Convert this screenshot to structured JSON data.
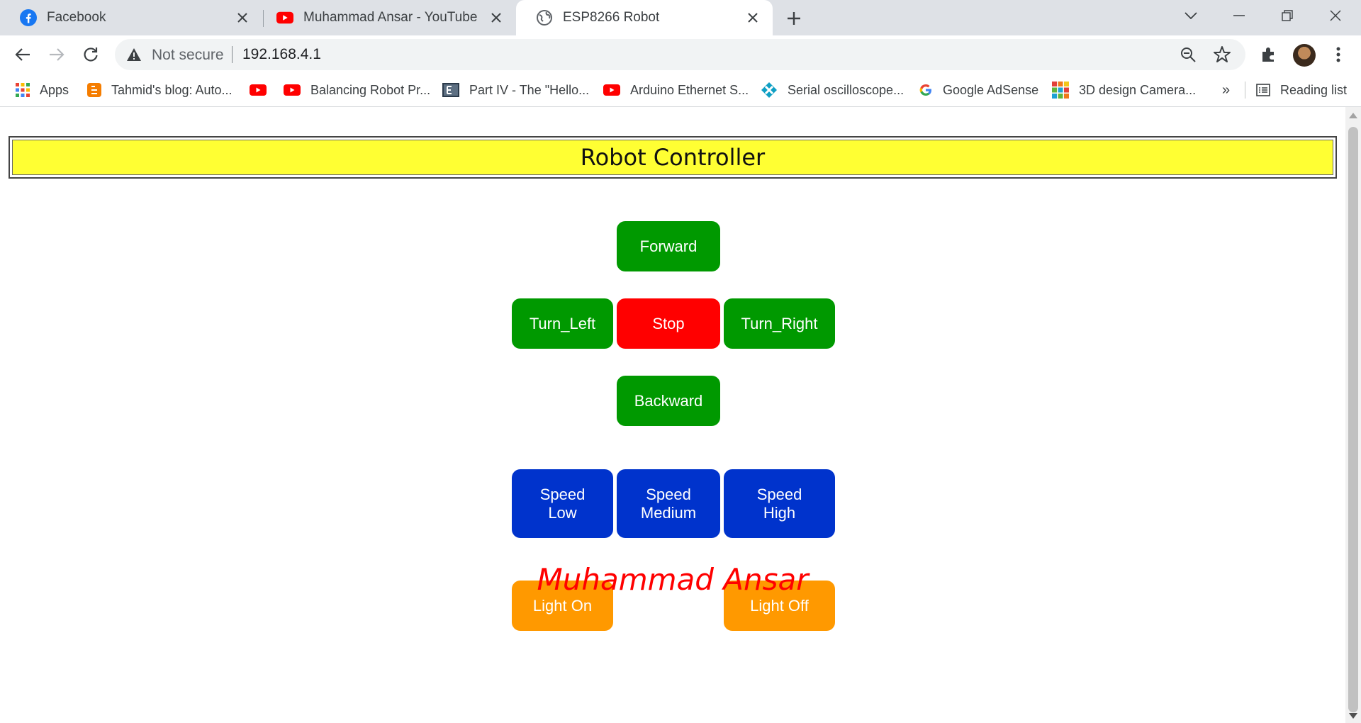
{
  "browser": {
    "tabs": [
      {
        "title": "Facebook",
        "icon": "facebook-icon"
      },
      {
        "title": "Muhammad Ansar - YouTube",
        "icon": "youtube-icon"
      },
      {
        "title": "ESP8266 Robot",
        "icon": "globe-icon",
        "active": true
      }
    ],
    "security_label": "Not secure",
    "url": "192.168.4.1",
    "bookmarks": [
      {
        "label": "Apps",
        "icon": "apps-grid-icon"
      },
      {
        "label": "Tahmid's blog: Auto...",
        "icon": "blogger-icon"
      },
      {
        "label": "",
        "icon": "youtube-icon"
      },
      {
        "label": "Balancing Robot Pr...",
        "icon": "youtube-icon"
      },
      {
        "label": "Part IV - The \"Hello...",
        "icon": "page-icon"
      },
      {
        "label": "Arduino Ethernet S...",
        "icon": "youtube-icon"
      },
      {
        "label": "Serial oscilloscope...",
        "icon": "oscilloscope-icon"
      },
      {
        "label": "Google AdSense",
        "icon": "google-icon"
      },
      {
        "label": "3D design Camera...",
        "icon": "tinkercad-icon"
      }
    ],
    "more_bookmarks": "»",
    "reading_list": "Reading list"
  },
  "page": {
    "title": "Robot Controller",
    "buttons": {
      "forward": "Forward",
      "turn_left": "Turn_Left",
      "stop": "Stop",
      "turn_right": "Turn_Right",
      "backward": "Backward",
      "speed_low": "Speed Low",
      "speed_medium": "Speed Medium",
      "speed_high": "Speed High",
      "light_on": "Light On",
      "light_off": "Light Off"
    },
    "signature": "Muhammad Ansar"
  },
  "colors": {
    "header_bg": "#ffff33",
    "move": "#009900",
    "stop": "#ff0000",
    "speed": "#0033cc",
    "light": "#ff9900",
    "signature": "#ff0000"
  }
}
